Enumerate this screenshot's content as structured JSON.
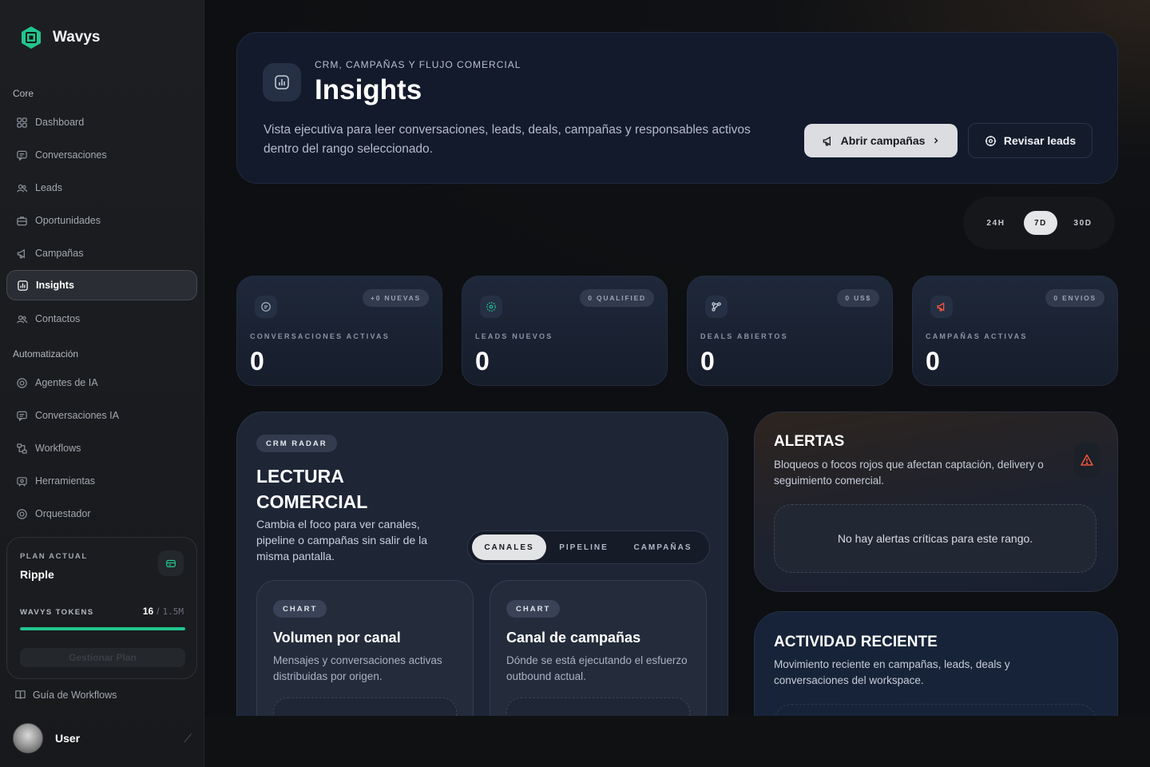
{
  "brand": {
    "name": "Wavys",
    "accent": "#22c58e"
  },
  "sidebar": {
    "sections": {
      "core": "Core",
      "automation": "Automatización"
    },
    "core_items": [
      {
        "label": "Dashboard",
        "icon": "grid-icon"
      },
      {
        "label": "Conversaciones",
        "icon": "chat-icon"
      },
      {
        "label": "Leads",
        "icon": "users-icon"
      },
      {
        "label": "Oportunidades",
        "icon": "briefcase-icon"
      },
      {
        "label": "Campañas",
        "icon": "megaphone-icon"
      },
      {
        "label": "Insights",
        "icon": "chart-icon",
        "active": true
      },
      {
        "label": "Contactos",
        "icon": "contacts-icon"
      }
    ],
    "automation_items": [
      {
        "label": "Agentes de IA",
        "icon": "agent-icon"
      },
      {
        "label": "Conversaciones IA",
        "icon": "chat-ai-icon"
      },
      {
        "label": "Workflows",
        "icon": "workflow-icon"
      },
      {
        "label": "Herramientas",
        "icon": "tools-icon"
      },
      {
        "label": "Orquestador",
        "icon": "orchestrator-icon"
      }
    ],
    "plan": {
      "label": "PLAN ACTUAL",
      "name": "Ripple",
      "tokens_label": "WAVYS TOKENS",
      "tokens_used": "16",
      "tokens_separator": "/",
      "tokens_max": "1.5M",
      "tokens_progress": 1.0,
      "button": "Gestionar Plan"
    },
    "guide": "Guía de Workflows",
    "user": "User"
  },
  "hero": {
    "kicker": "CRM, CAMPAÑAS Y FLUJO COMERCIAL",
    "title": "Insights",
    "description": "Vista ejecutiva para leer conversaciones, leads, deals, campañas y responsables activos dentro del rango seleccionado.",
    "primary_button": "Abrir campañas",
    "secondary_button": "Revisar leads"
  },
  "range": {
    "options": [
      "24H",
      "7D",
      "30D"
    ],
    "selected": "7D"
  },
  "stats": [
    {
      "badge": "+0 NUEVAS",
      "label": "CONVERSACIONES ACTIVAS",
      "value": "0",
      "icon": "chat-icon"
    },
    {
      "badge": "0 QUALIFIED",
      "label": "LEADS NUEVOS",
      "value": "0",
      "icon": "target-icon"
    },
    {
      "badge": "0 US$",
      "label": "DEALS ABIERTOS",
      "value": "0",
      "icon": "branch-icon"
    },
    {
      "badge": "0 ENVIOS",
      "label": "CAMPAÑAS ACTIVAS",
      "value": "0",
      "icon": "megaphone-icon"
    }
  ],
  "radar": {
    "chip": "CRM RADAR",
    "title": "LECTURA COMERCIAL",
    "description": "Cambia el foco para ver canales, pipeline o campañas sin salir de la misma pantalla.",
    "tabs": [
      "CANALES",
      "PIPELINE",
      "CAMPAÑAS"
    ],
    "selected_tab": "CANALES",
    "charts": [
      {
        "chip": "CHART",
        "title": "Volumen por canal",
        "description": "Mensajes y conversaciones activas distribuidas por origen."
      },
      {
        "chip": "CHART",
        "title": "Canal de campañas",
        "description": "Dónde se está ejecutando el esfuerzo outbound actual."
      }
    ]
  },
  "alerts": {
    "title": "ALERTAS",
    "description": "Bloqueos o focos rojos que afectan captación, delivery o seguimiento comercial.",
    "empty": "No hay alertas críticas para este rango."
  },
  "activity": {
    "title": "ACTIVIDAD RECIENTE",
    "description": "Movimiento reciente en campañas, leads, deals y conversaciones del workspace."
  }
}
